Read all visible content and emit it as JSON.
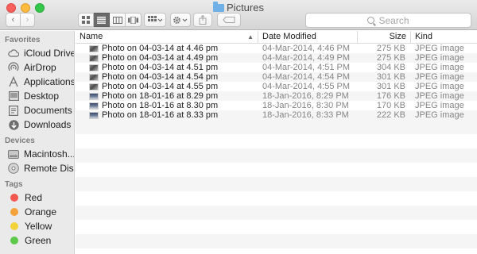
{
  "window": {
    "title": "Pictures"
  },
  "toolbar": {
    "back_glyph": "‹",
    "forward_glyph": "›",
    "view_modes": [
      "icon-view",
      "list-view",
      "column-view",
      "cover-flow-view"
    ],
    "active_view": "list-view",
    "search_placeholder": "Search"
  },
  "sidebar": {
    "favorites_heading": "Favorites",
    "favorites": [
      {
        "label": "iCloud Drive",
        "icon": "cloud-icon"
      },
      {
        "label": "AirDrop",
        "icon": "airdrop-icon"
      },
      {
        "label": "Applications",
        "icon": "applications-icon"
      },
      {
        "label": "Desktop",
        "icon": "desktop-icon"
      },
      {
        "label": "Documents",
        "icon": "documents-icon"
      },
      {
        "label": "Downloads",
        "icon": "downloads-icon"
      }
    ],
    "devices_heading": "Devices",
    "devices": [
      {
        "label": "Macintosh...",
        "icon": "hard-drive-icon"
      },
      {
        "label": "Remote Disc",
        "icon": "disc-icon"
      }
    ],
    "tags_heading": "Tags",
    "tags": [
      {
        "label": "Red",
        "color": "#f4574f"
      },
      {
        "label": "Orange",
        "color": "#f5a23a"
      },
      {
        "label": "Yellow",
        "color": "#f4d33a"
      },
      {
        "label": "Green",
        "color": "#5cc94a"
      }
    ]
  },
  "columns": {
    "name": "Name",
    "date": "Date Modified",
    "size": "Size",
    "kind": "Kind"
  },
  "files": [
    {
      "name": "Photo on 04-03-14 at 4.46 pm",
      "date": "04-Mar-2014, 4:46 PM",
      "size": "275 KB",
      "kind": "JPEG image"
    },
    {
      "name": "Photo on 04-03-14 at 4.49 pm",
      "date": "04-Mar-2014, 4:49 PM",
      "size": "275 KB",
      "kind": "JPEG image"
    },
    {
      "name": "Photo on 04-03-14 at 4.51 pm",
      "date": "04-Mar-2014, 4:51 PM",
      "size": "304 KB",
      "kind": "JPEG image"
    },
    {
      "name": "Photo on 04-03-14 at 4.54 pm",
      "date": "04-Mar-2014, 4:54 PM",
      "size": "301 KB",
      "kind": "JPEG image"
    },
    {
      "name": "Photo on 04-03-14 at 4.55 pm",
      "date": "04-Mar-2014, 4:55 PM",
      "size": "301 KB",
      "kind": "JPEG image"
    },
    {
      "name": "Photo on 18-01-16 at 8.29 pm",
      "date": "18-Jan-2016, 8:29 PM",
      "size": "176 KB",
      "kind": "JPEG image"
    },
    {
      "name": "Photo on 18-01-16 at 8.30 pm",
      "date": "18-Jan-2016, 8:30 PM",
      "size": "170 KB",
      "kind": "JPEG image"
    },
    {
      "name": "Photo on 18-01-16 at 8.33 pm",
      "date": "18-Jan-2016, 8:33 PM",
      "size": "222 KB",
      "kind": "JPEG image"
    }
  ]
}
